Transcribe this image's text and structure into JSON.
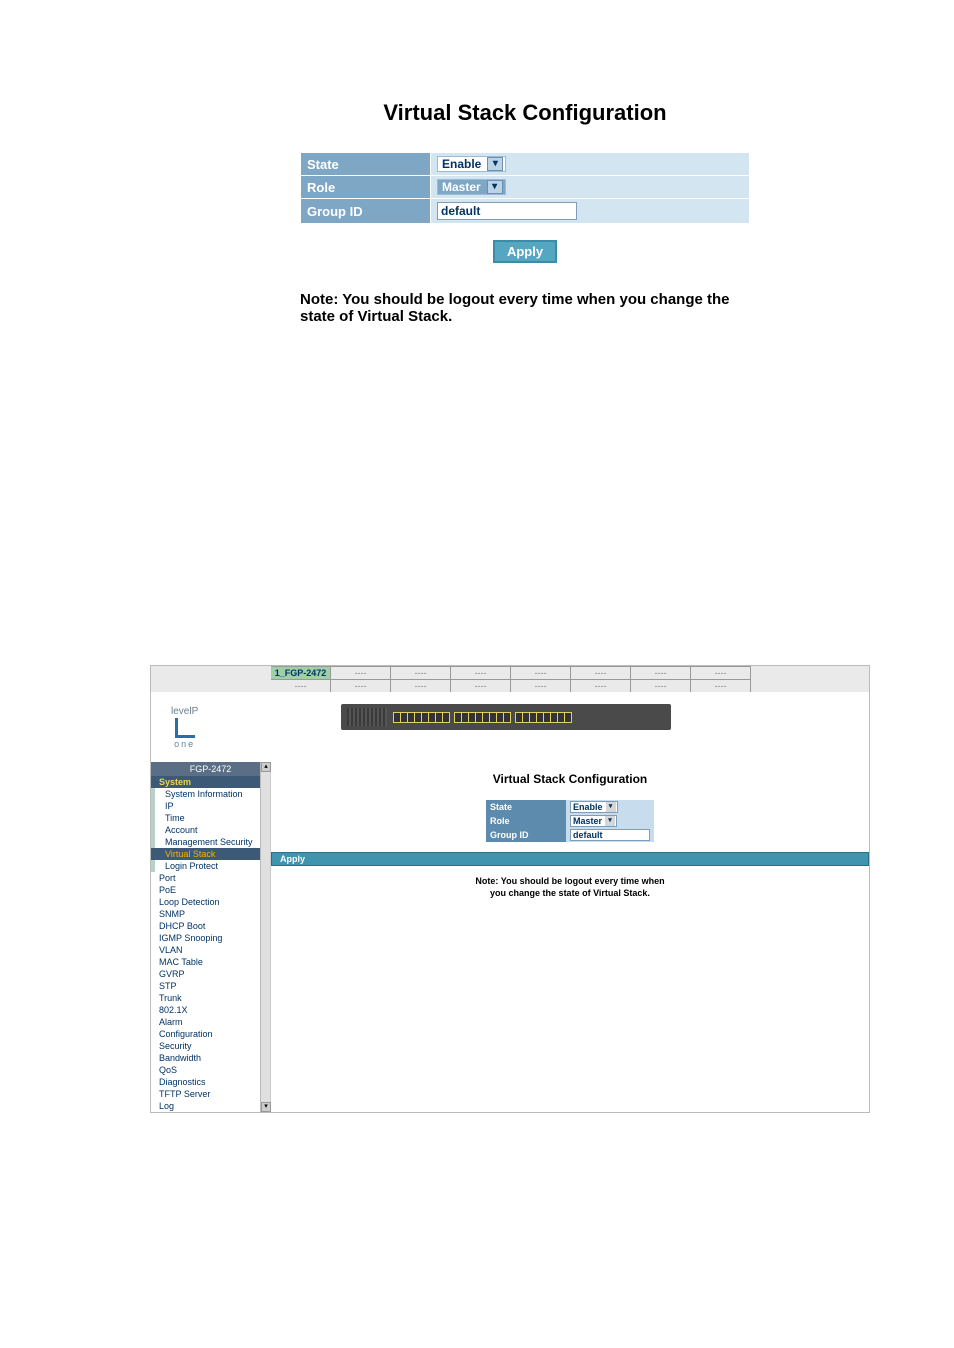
{
  "top": {
    "title": "Virtual Stack Configuration",
    "rows": {
      "state_label": "State",
      "state_value": "Enable",
      "role_label": "Role",
      "role_value": "Master",
      "group_label": "Group ID",
      "group_value": "default"
    },
    "apply": "Apply",
    "note": "Note: You should be logout every time when you change the state of Virtual Stack."
  },
  "bottom": {
    "tab_active": "1_FGP-2472",
    "tab_placeholder": "----",
    "logo": {
      "brand": "levelP",
      "one": "one"
    },
    "device_header": "FGP-2472",
    "nav": [
      {
        "label": "System",
        "kind": "system"
      },
      {
        "label": "System Information",
        "kind": "sub"
      },
      {
        "label": "IP",
        "kind": "sub"
      },
      {
        "label": "Time",
        "kind": "sub"
      },
      {
        "label": "Account",
        "kind": "sub"
      },
      {
        "label": "Management Security",
        "kind": "sub"
      },
      {
        "label": "Virtual Stack",
        "kind": "active"
      },
      {
        "label": "Login Protect",
        "kind": "sub"
      },
      {
        "label": "Port",
        "kind": "cat"
      },
      {
        "label": "PoE",
        "kind": "cat"
      },
      {
        "label": "Loop Detection",
        "kind": "cat"
      },
      {
        "label": "SNMP",
        "kind": "cat"
      },
      {
        "label": "DHCP Boot",
        "kind": "cat"
      },
      {
        "label": "IGMP Snooping",
        "kind": "cat"
      },
      {
        "label": "VLAN",
        "kind": "cat"
      },
      {
        "label": "MAC Table",
        "kind": "cat"
      },
      {
        "label": "GVRP",
        "kind": "cat"
      },
      {
        "label": "STP",
        "kind": "cat"
      },
      {
        "label": "Trunk",
        "kind": "cat"
      },
      {
        "label": "802.1X",
        "kind": "cat"
      },
      {
        "label": "Alarm",
        "kind": "cat"
      },
      {
        "label": "Configuration",
        "kind": "cat"
      },
      {
        "label": "Security",
        "kind": "cat"
      },
      {
        "label": "Bandwidth",
        "kind": "cat"
      },
      {
        "label": "QoS",
        "kind": "cat"
      },
      {
        "label": "Diagnostics",
        "kind": "cat"
      },
      {
        "label": "TFTP Server",
        "kind": "cat"
      },
      {
        "label": "Log",
        "kind": "cat"
      }
    ],
    "mini": {
      "title": "Virtual Stack Configuration",
      "state_label": "State",
      "state_value": "Enable",
      "role_label": "Role",
      "role_value": "Master",
      "group_label": "Group ID",
      "group_value": "default",
      "apply": "Apply",
      "note1": "Note: You should be logout every time when",
      "note2": "you change the state of Virtual Stack."
    }
  }
}
